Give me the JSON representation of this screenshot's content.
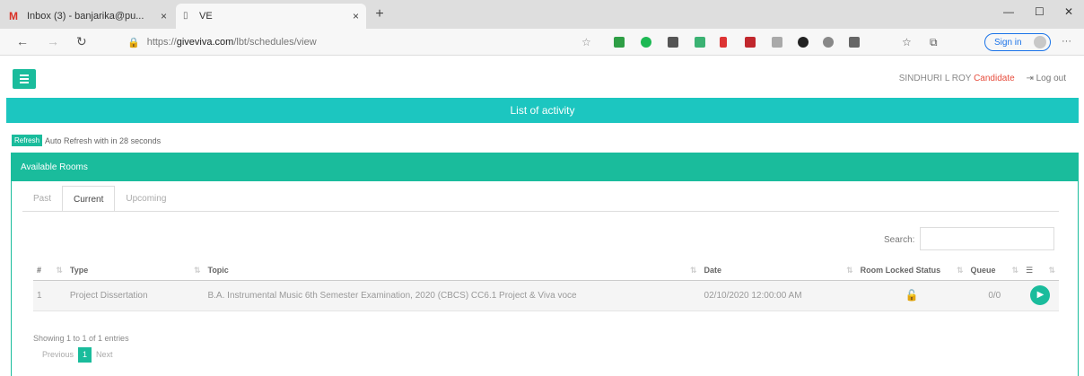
{
  "browser": {
    "tabs": [
      {
        "label": "Inbox (3) - banjarika@pu...",
        "icon": "gmail-icon"
      },
      {
        "label": "VE",
        "icon": "page-icon"
      }
    ],
    "url_prefix": "https://",
    "url_domain": "giveviva.com",
    "url_path": "/lbt/schedules/view",
    "sign_in_label": "Sign in"
  },
  "header": {
    "user_name": "SINDHURI L ROY",
    "role": "Candidate",
    "logout_label": "Log out"
  },
  "banner": {
    "title": "List of activity"
  },
  "refresh": {
    "button_label": "Refresh",
    "text": "Auto Refresh with in 28 seconds"
  },
  "panel": {
    "title": "Available Rooms"
  },
  "tabs": [
    {
      "label": "Past"
    },
    {
      "label": "Current",
      "active": true
    },
    {
      "label": "Upcoming"
    }
  ],
  "search": {
    "label": "Search:",
    "value": ""
  },
  "table": {
    "columns": [
      "#",
      "Type",
      "Topic",
      "Date",
      "Room Locked Status",
      "Queue",
      ""
    ],
    "rows": [
      {
        "num": "1",
        "type": "Project Dissertation",
        "topic": "B.A. Instrumental Music 6th Semester Examination, 2020 (CBCS) CC6.1 Project & Viva voce",
        "date": "02/10/2020 12:00:00 AM",
        "locked_status": "unlocked",
        "queue": "0/0"
      }
    ]
  },
  "footer": {
    "showing": "Showing 1 to 1 of 1 entries",
    "prev_label": "Previous",
    "current_page": "1",
    "next_label": "Next"
  },
  "colors": {
    "accent": "#1abc9c",
    "banner": "#1cc6c0",
    "role": "#e74c3c"
  }
}
